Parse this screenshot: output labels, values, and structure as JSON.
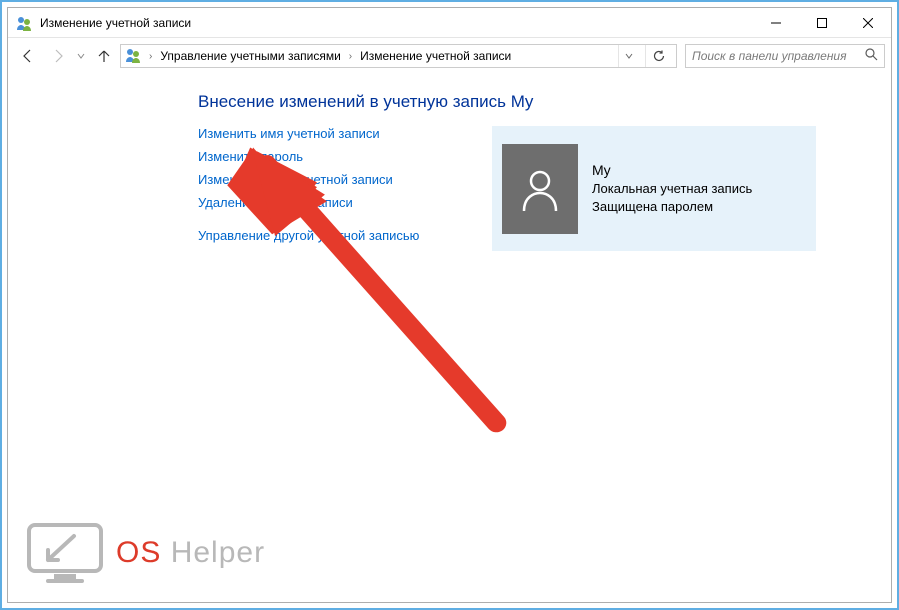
{
  "window": {
    "title": "Изменение учетной записи"
  },
  "nav": {
    "breadcrumb1": "Управление учетными записями",
    "breadcrumb2": "Изменение учетной записи"
  },
  "search": {
    "placeholder": "Поиск в панели управления"
  },
  "page": {
    "heading": "Внесение изменений в учетную запись My"
  },
  "links": {
    "rename": "Изменить имя учетной записи",
    "change_password": "Изменить пароль",
    "change_type": "Изменение типа учетной записи",
    "delete": "Удаление учетной записи",
    "manage_other": "Управление другой учетной записью"
  },
  "account": {
    "name": "My",
    "type": "Локальная учетная запись",
    "status": "Защищена паролем"
  },
  "watermark": {
    "os": "OS",
    "helper": " Helper"
  }
}
